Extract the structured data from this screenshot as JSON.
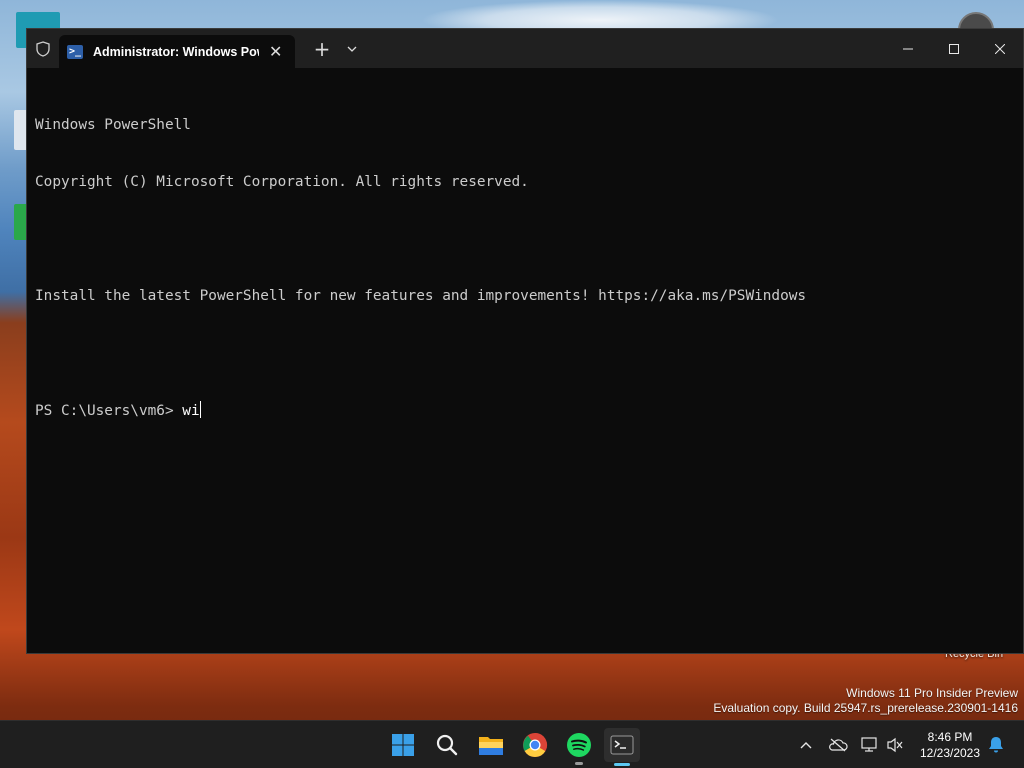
{
  "terminal": {
    "tab_title": "Administrator: Windows Powe",
    "lines": [
      "Windows PowerShell",
      "Copyright (C) Microsoft Corporation. All rights reserved.",
      "",
      "Install the latest PowerShell for new features and improvements! https://aka.ms/PSWindows",
      ""
    ],
    "prompt": "PS C:\\Users\\vm6> ",
    "input": "wi"
  },
  "desktop": {
    "recycle_bin_label": "Recycle Bin",
    "watermark_line1": "Windows 11 Pro Insider Preview",
    "watermark_line2": "Evaluation copy. Build 25947.rs_prerelease.230901-1416"
  },
  "taskbar": {
    "time": "8:46 PM",
    "date": "12/23/2023",
    "pinned": [
      "start-icon",
      "search-icon",
      "file-explorer-icon",
      "chrome-icon",
      "spotify-icon",
      "terminal-icon"
    ]
  },
  "colors": {
    "terminal_bg": "#0c0c0c",
    "titlebar_bg": "#202020",
    "taskbar_bg": "#1f1f1f",
    "accent": "#5cc8f2"
  }
}
